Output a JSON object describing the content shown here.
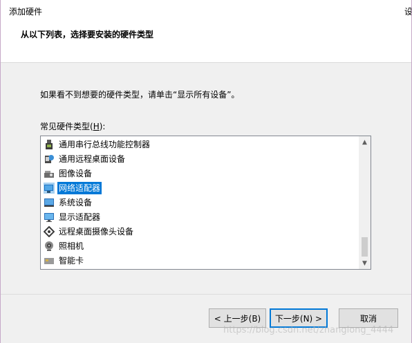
{
  "window": {
    "title": "添加硬件",
    "subtitle": "从以下列表，选择要安装的硬件类型",
    "corner_char": "设"
  },
  "main": {
    "instruction": "如果看不到想要的硬件类型，请单击“显示所有设备”。",
    "list_label_prefix": "常见硬件类型(",
    "list_label_hotkey": "H",
    "list_label_suffix": "):"
  },
  "hardware_list": {
    "items": [
      {
        "label": "通用串行总线功能控制器",
        "icon": "usb-controller-icon",
        "selected": false
      },
      {
        "label": "通用远程桌面设备",
        "icon": "remote-desktop-device-icon",
        "selected": false
      },
      {
        "label": "图像设备",
        "icon": "imaging-device-icon",
        "selected": false
      },
      {
        "label": "网络适配器",
        "icon": "network-adapter-icon",
        "selected": true
      },
      {
        "label": "系统设备",
        "icon": "system-device-icon",
        "selected": false
      },
      {
        "label": "显示适配器",
        "icon": "display-adapter-icon",
        "selected": false
      },
      {
        "label": "远程桌面摄像头设备",
        "icon": "remote-camera-icon",
        "selected": false
      },
      {
        "label": "照相机",
        "icon": "camera-icon",
        "selected": false
      },
      {
        "label": "智能卡",
        "icon": "smart-card-icon",
        "selected": false
      }
    ],
    "selection_color": "#0078d7"
  },
  "buttons": {
    "back_label": "< 上一步(B)",
    "next_label": "下一步(N) >",
    "cancel_label": "取消"
  },
  "watermark": "https://blog.csdn.net/zhanglong_4444"
}
